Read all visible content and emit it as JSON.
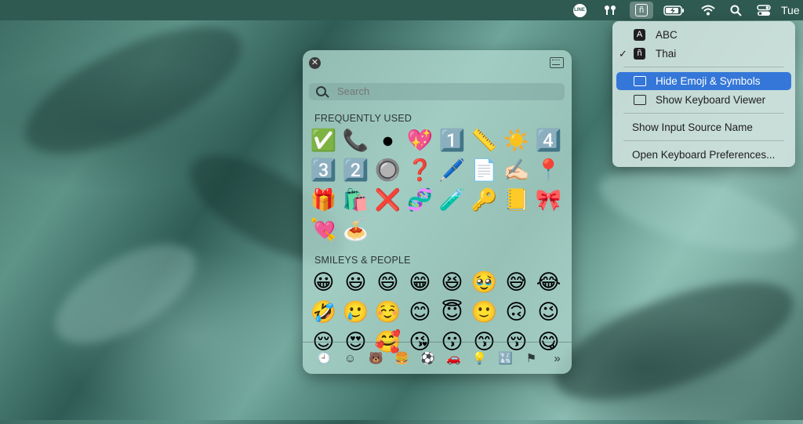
{
  "menubar": {
    "line_icon_text": "LINE",
    "input_source_glyph": "ñ",
    "clock": "Tue"
  },
  "emoji_panel": {
    "search_placeholder": "Search",
    "sections": [
      {
        "title": "FREQUENTLY USED",
        "emojis": [
          "✅",
          "📞",
          "●",
          "💖",
          "1️⃣",
          "📏",
          "☀️",
          "4️⃣",
          "3️⃣",
          "2️⃣",
          "🔘",
          "❓",
          "🖊️",
          "📄",
          "✍🏻",
          "📍",
          "🎁",
          "🛍️",
          "❌",
          "🧬",
          "🧪",
          "🔑",
          "📒",
          "🎀",
          "💘",
          "🍝"
        ]
      },
      {
        "title": "SMILEYS & PEOPLE",
        "emojis": [
          "😀",
          "😃",
          "😄",
          "😁",
          "😆",
          "🥹",
          "😅",
          "😂",
          "🤣",
          "🥲",
          "☺️",
          "😊",
          "😇",
          "🙂",
          "🙃",
          "😉",
          "😌",
          "😍",
          "🥰",
          "😘",
          "😗",
          "😙",
          "😚",
          "😋"
        ]
      }
    ],
    "categories": [
      "🕘",
      "☺",
      "🐻",
      "🍔",
      "⚽",
      "🚗",
      "💡",
      "🔣",
      "⚑",
      "»"
    ]
  },
  "input_menu": {
    "abc": {
      "badge": "A",
      "label": "ABC"
    },
    "thai": {
      "check": "✓",
      "badge": "ñ",
      "label": "Thai"
    },
    "hide_emoji": "Hide Emoji & Symbols",
    "show_keyboard_viewer": "Show Keyboard Viewer",
    "show_input_source_name": "Show Input Source Name",
    "open_keyboard_prefs": "Open Keyboard Preferences..."
  }
}
